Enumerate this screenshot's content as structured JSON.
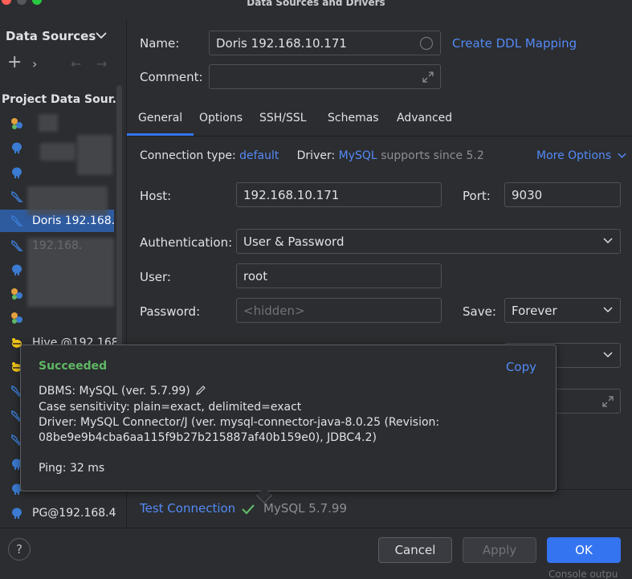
{
  "window": {
    "title": "Data Sources and Drivers"
  },
  "sidebar": {
    "header_label": "Data Sources",
    "group_label": "Project Data Sour..",
    "items": [
      {
        "label": "",
        "icon": "mixed-db-icon"
      },
      {
        "label": "",
        "icon": "postgres-elephant-icon"
      },
      {
        "label": "",
        "icon": "postgres-elephant-icon"
      },
      {
        "label": "",
        "icon": "mysql-dolphin-icon"
      },
      {
        "label": "Doris 192.168.",
        "icon": "mysql-dolphin-icon"
      },
      {
        "label": "192.168.",
        "icon": "mysql-dolphin-icon"
      },
      {
        "label": "",
        "icon": "postgres-elephant-icon"
      },
      {
        "label": "",
        "icon": "mixed-db-icon"
      },
      {
        "label": "",
        "icon": "mixed-db-icon"
      },
      {
        "label": "Hive @192.168",
        "icon": "hive-bee-icon"
      },
      {
        "label": "",
        "icon": "hive-bee-icon"
      },
      {
        "label": "",
        "icon": "mysql-dolphin-icon"
      },
      {
        "label": "",
        "icon": "mysql-dolphin-icon"
      },
      {
        "label": "",
        "icon": "mysql-dolphin-icon"
      },
      {
        "label": "",
        "icon": "postgres-elephant-icon"
      },
      {
        "label": "",
        "icon": "postgres-elephant-icon"
      },
      {
        "label": "PG@192.168.4",
        "icon": "postgres-elephant-icon"
      }
    ]
  },
  "form": {
    "name_label": "Name:",
    "name_value": "Doris 192.168.10.171",
    "ddl_link": "Create DDL Mapping",
    "comment_label": "Comment:",
    "comment_value": "",
    "tabs": [
      "General",
      "Options",
      "SSH/SSL",
      "Schemas",
      "Advanced"
    ],
    "active_tab": "General",
    "connection_type_label": "Connection type:",
    "connection_type_value": "default",
    "driver_label": "Driver:",
    "driver_value": "MySQL",
    "driver_note": "supports since 5.2",
    "more_options": "More Options",
    "host_label": "Host:",
    "host_value": "192.168.10.171",
    "port_label": "Port:",
    "port_value": "9030",
    "auth_label": "Authentication:",
    "auth_value": "User & Password",
    "user_label": "User:",
    "user_value": "root",
    "password_label": "Password:",
    "password_placeholder": "<hidden>",
    "save_label": "Save:",
    "save_value": "Forever"
  },
  "popup": {
    "status": "Succeeded",
    "copy": "Copy",
    "dbms": "DBMS: MySQL (ver. 5.7.99)",
    "case_sensitivity": "Case sensitivity: plain=exact, delimited=exact",
    "driver_line1": "Driver: MySQL Connector/J (ver. mysql-connector-java-8.0.25 (Revision:",
    "driver_line2": "08be9e9b4cba6aa115f9b27b215887af40b159e0), JDBC4.2)",
    "ping": "Ping: 32 ms"
  },
  "test_connection": {
    "label": "Test Connection",
    "result": "MySQL 5.7.99"
  },
  "footer": {
    "help": "?",
    "cancel": "Cancel",
    "apply": "Apply",
    "ok": "OK",
    "console_peek": "Console outpu"
  },
  "colors": {
    "accent": "#3574f0",
    "link": "#548af7",
    "success": "#5fb865",
    "selection": "#2e5a9e"
  }
}
